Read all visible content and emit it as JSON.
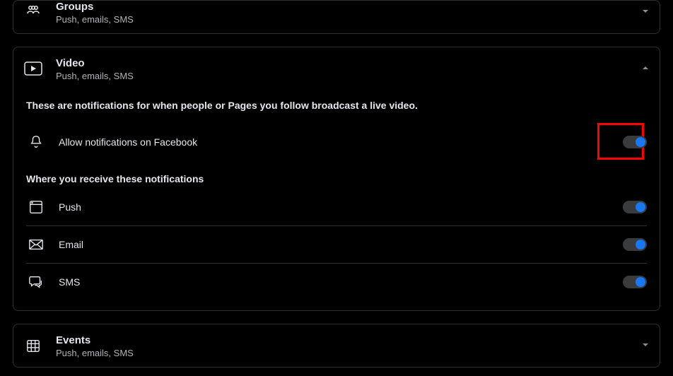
{
  "groups": {
    "title": "Groups",
    "subtitle": "Push, emails, SMS"
  },
  "video": {
    "title": "Video",
    "subtitle": "Push, emails, SMS",
    "description": "These are notifications for when people or Pages you follow broadcast a live video.",
    "allow_label": "Allow notifications on Facebook",
    "section_heading": "Where you receive these notifications",
    "channels": {
      "push": "Push",
      "email": "Email",
      "sms": "SMS"
    }
  },
  "events": {
    "title": "Events",
    "subtitle": "Push, emails, SMS"
  }
}
